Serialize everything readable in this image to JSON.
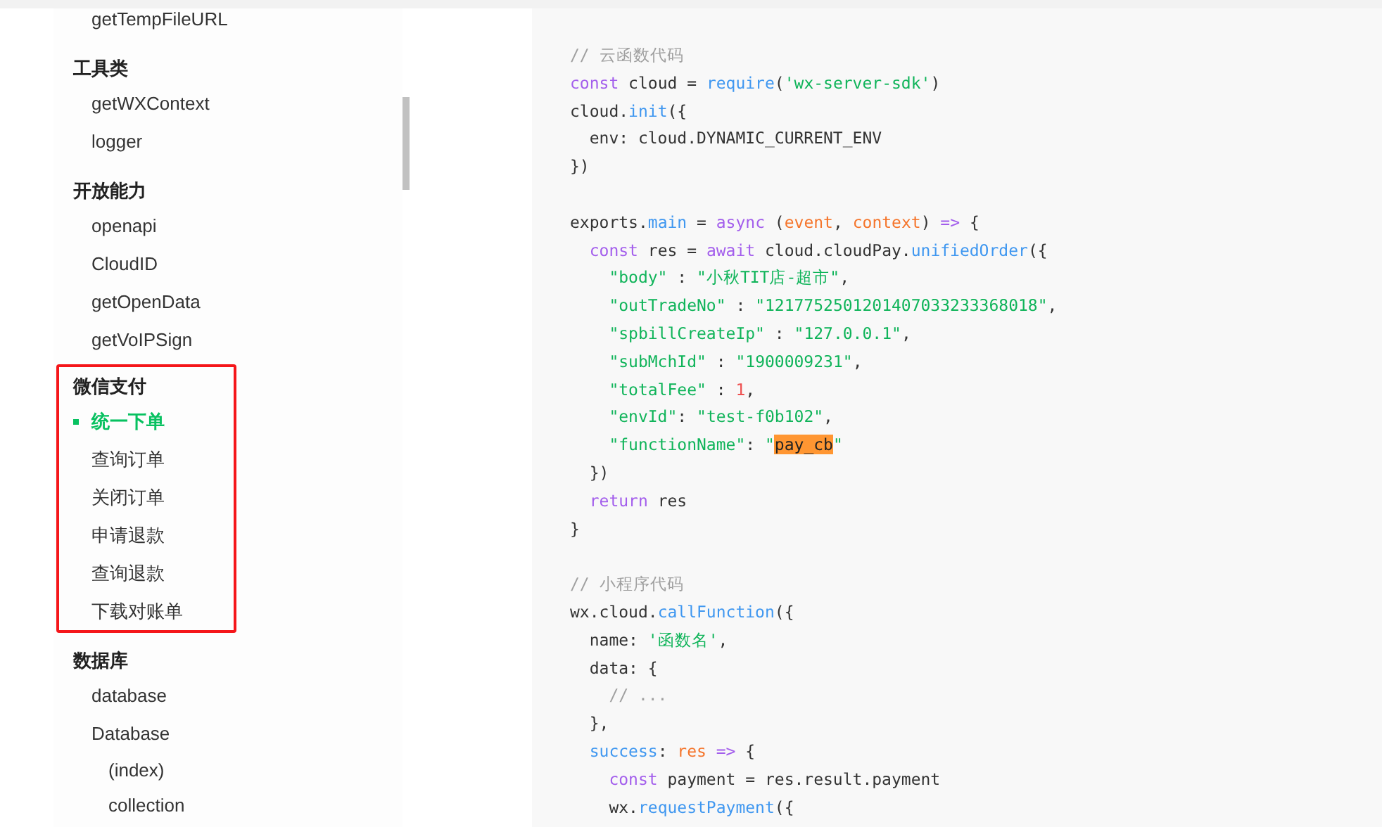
{
  "sidebar": {
    "groups": [
      {
        "items": [
          {
            "label": "getTempFileURL",
            "selected": false
          }
        ]
      },
      {
        "heading": "工具类",
        "highlighted": false,
        "items": [
          {
            "label": "getWXContext",
            "selected": false
          },
          {
            "label": "logger",
            "selected": false
          }
        ]
      },
      {
        "heading": "开放能力",
        "highlighted": false,
        "items": [
          {
            "label": "openapi",
            "selected": false
          },
          {
            "label": "CloudID",
            "selected": false
          },
          {
            "label": "getOpenData",
            "selected": false
          },
          {
            "label": "getVoIPSign",
            "selected": false
          }
        ]
      },
      {
        "heading": "微信支付",
        "highlighted": true,
        "items": [
          {
            "label": "统一下单",
            "selected": true
          },
          {
            "label": "查询订单",
            "selected": false
          },
          {
            "label": "关闭订单",
            "selected": false
          },
          {
            "label": "申请退款",
            "selected": false
          },
          {
            "label": "查询退款",
            "selected": false
          },
          {
            "label": "下载对账单",
            "selected": false
          }
        ]
      },
      {
        "heading": "数据库",
        "highlighted": false,
        "items": [
          {
            "label": "database",
            "selected": false
          },
          {
            "label": "Database",
            "selected": false,
            "children": [
              {
                "label": "(index)",
                "selected": false
              },
              {
                "label": "collection",
                "selected": false
              }
            ]
          }
        ]
      }
    ]
  },
  "code": {
    "lines": [
      {
        "tokens": [
          {
            "kind": "comment",
            "text": "// 云函数代码"
          }
        ]
      },
      {
        "tokens": [
          {
            "kind": "keyword",
            "text": "const"
          },
          {
            "kind": "plain",
            "text": " cloud = "
          },
          {
            "kind": "func",
            "text": "require"
          },
          {
            "kind": "plain",
            "text": "("
          },
          {
            "kind": "string",
            "text": "'wx-server-sdk'"
          },
          {
            "kind": "plain",
            "text": ")"
          }
        ]
      },
      {
        "tokens": [
          {
            "kind": "plain",
            "text": "cloud."
          },
          {
            "kind": "func",
            "text": "init"
          },
          {
            "kind": "plain",
            "text": "({"
          }
        ]
      },
      {
        "tokens": [
          {
            "kind": "plain",
            "text": "  env: cloud.DYNAMIC_CURRENT_ENV"
          }
        ]
      },
      {
        "tokens": [
          {
            "kind": "plain",
            "text": "})"
          }
        ]
      },
      {
        "gap_before": true,
        "tokens": [
          {
            "kind": "plain",
            "text": "exports."
          },
          {
            "kind": "func",
            "text": "main"
          },
          {
            "kind": "plain",
            "text": " = "
          },
          {
            "kind": "keyword",
            "text": "async"
          },
          {
            "kind": "plain",
            "text": " ("
          },
          {
            "kind": "param",
            "text": "event"
          },
          {
            "kind": "plain",
            "text": ", "
          },
          {
            "kind": "param",
            "text": "context"
          },
          {
            "kind": "plain",
            "text": ") "
          },
          {
            "kind": "keyword",
            "text": "=>"
          },
          {
            "kind": "plain",
            "text": " {"
          }
        ]
      },
      {
        "tokens": [
          {
            "kind": "keyword",
            "text": "  const"
          },
          {
            "kind": "plain",
            "text": " res = "
          },
          {
            "kind": "keyword",
            "text": "await"
          },
          {
            "kind": "plain",
            "text": " cloud.cloudPay."
          },
          {
            "kind": "func",
            "text": "unifiedOrder"
          },
          {
            "kind": "plain",
            "text": "({"
          }
        ]
      },
      {
        "tokens": [
          {
            "kind": "string",
            "text": "    \"body\""
          },
          {
            "kind": "plain",
            "text": " : "
          },
          {
            "kind": "string",
            "text": "\"小秋TIT店-超市\""
          },
          {
            "kind": "plain",
            "text": ","
          }
        ]
      },
      {
        "tokens": [
          {
            "kind": "string",
            "text": "    \"outTradeNo\""
          },
          {
            "kind": "plain",
            "text": " : "
          },
          {
            "kind": "string",
            "text": "\"1217752501201407033233368018\""
          },
          {
            "kind": "plain",
            "text": ","
          }
        ]
      },
      {
        "tokens": [
          {
            "kind": "string",
            "text": "    \"spbillCreateIp\""
          },
          {
            "kind": "plain",
            "text": " : "
          },
          {
            "kind": "string",
            "text": "\"127.0.0.1\""
          },
          {
            "kind": "plain",
            "text": ","
          }
        ]
      },
      {
        "tokens": [
          {
            "kind": "string",
            "text": "    \"subMchId\""
          },
          {
            "kind": "plain",
            "text": " : "
          },
          {
            "kind": "string",
            "text": "\"1900009231\""
          },
          {
            "kind": "plain",
            "text": ","
          }
        ]
      },
      {
        "tokens": [
          {
            "kind": "string",
            "text": "    \"totalFee\""
          },
          {
            "kind": "plain",
            "text": " : "
          },
          {
            "kind": "number",
            "text": "1"
          },
          {
            "kind": "plain",
            "text": ","
          }
        ]
      },
      {
        "tokens": [
          {
            "kind": "string",
            "text": "    \"envId\""
          },
          {
            "kind": "plain",
            "text": ": "
          },
          {
            "kind": "string",
            "text": "\"test-f0b102\""
          },
          {
            "kind": "plain",
            "text": ","
          }
        ]
      },
      {
        "tokens": [
          {
            "kind": "string",
            "text": "    \"functionName\""
          },
          {
            "kind": "plain",
            "text": ": "
          },
          {
            "kind": "string",
            "text": "\""
          },
          {
            "kind": "highlight",
            "text": "pay_cb"
          },
          {
            "kind": "string",
            "text": "\""
          }
        ]
      },
      {
        "tokens": [
          {
            "kind": "plain",
            "text": "  })"
          }
        ]
      },
      {
        "tokens": [
          {
            "kind": "keyword",
            "text": "  return"
          },
          {
            "kind": "plain",
            "text": " res"
          }
        ]
      },
      {
        "tokens": [
          {
            "kind": "plain",
            "text": "}"
          }
        ]
      },
      {
        "gap_before": true,
        "tokens": [
          {
            "kind": "comment",
            "text": "// 小程序代码"
          }
        ]
      },
      {
        "tokens": [
          {
            "kind": "plain",
            "text": "wx.cloud."
          },
          {
            "kind": "func",
            "text": "callFunction"
          },
          {
            "kind": "plain",
            "text": "({"
          }
        ]
      },
      {
        "tokens": [
          {
            "kind": "plain",
            "text": "  name: "
          },
          {
            "kind": "string",
            "text": "'函数名'"
          },
          {
            "kind": "plain",
            "text": ","
          }
        ]
      },
      {
        "tokens": [
          {
            "kind": "plain",
            "text": "  data: {"
          }
        ]
      },
      {
        "tokens": [
          {
            "kind": "comment",
            "text": "    // ..."
          }
        ]
      },
      {
        "tokens": [
          {
            "kind": "plain",
            "text": "  },"
          }
        ]
      },
      {
        "tokens": [
          {
            "kind": "func",
            "text": "  success"
          },
          {
            "kind": "plain",
            "text": ": "
          },
          {
            "kind": "param",
            "text": "res"
          },
          {
            "kind": "keyword",
            "text": " =>"
          },
          {
            "kind": "plain",
            "text": " {"
          }
        ]
      },
      {
        "tokens": [
          {
            "kind": "keyword",
            "text": "    const"
          },
          {
            "kind": "plain",
            "text": " payment = res.result.payment"
          }
        ]
      },
      {
        "tokens": [
          {
            "kind": "plain",
            "text": "    wx."
          },
          {
            "kind": "func",
            "text": "requestPayment"
          },
          {
            "kind": "plain",
            "text": "({"
          }
        ]
      }
    ]
  }
}
